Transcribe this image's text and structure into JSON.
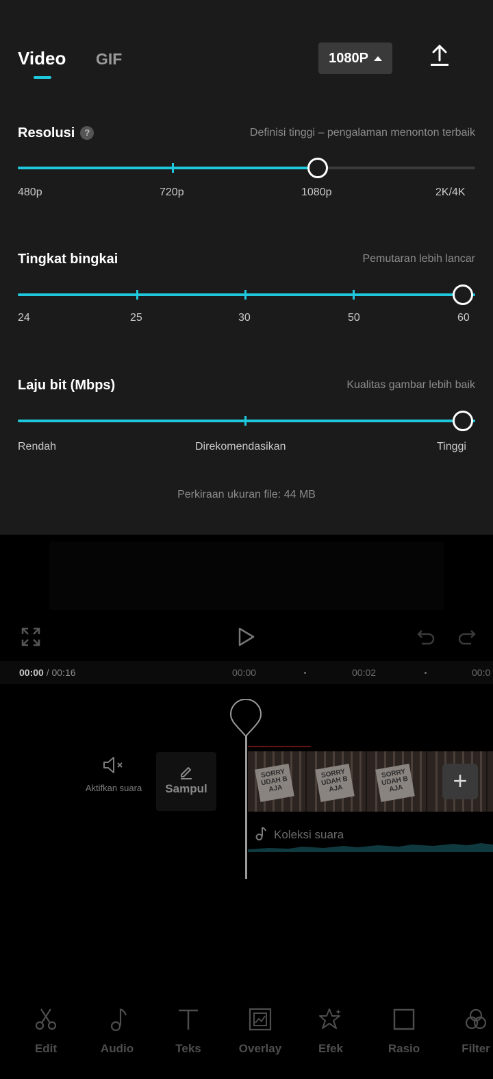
{
  "export": {
    "tabs": [
      {
        "label": "Video",
        "active": true
      },
      {
        "label": "GIF",
        "active": false
      }
    ],
    "resolution_button": "1080P",
    "resolution": {
      "title": "Resolusi",
      "help": "?",
      "hint": "Definisi tinggi – pengalaman menonton terbaik",
      "labels": [
        "480p",
        "720p",
        "1080p",
        "2K/4K"
      ],
      "selected": "1080p"
    },
    "frame_rate": {
      "title": "Tingkat bingkai",
      "hint": "Pemutaran lebih lancar",
      "labels": [
        "24",
        "25",
        "30",
        "50",
        "60"
      ],
      "selected": "60"
    },
    "bitrate": {
      "title": "Laju bit (Mbps)",
      "hint": "Kualitas gambar lebih baik",
      "labels": [
        "Rendah",
        "Direkomendasikan",
        "Tinggi"
      ],
      "selected": "Tinggi"
    },
    "file_size": "Perkiraan ukuran file: 44 MB"
  },
  "editor": {
    "current_time": "00:00",
    "total_time": " / 00:16",
    "ruler": [
      "00:00",
      "00:02",
      "00:0"
    ],
    "mute_label": "Aktifkan suara",
    "cover_label": "Sampul",
    "clip_sticker_text": "SORRY UDAH B AJA",
    "add_clip": "+",
    "audio_label": "Koleksi suara",
    "accent_color": "#1fc8dc",
    "toolbar": [
      {
        "label": "Edit",
        "icon": "scissors-icon"
      },
      {
        "label": "Audio",
        "icon": "music-note-icon"
      },
      {
        "label": "Teks",
        "icon": "text-icon"
      },
      {
        "label": "Overlay",
        "icon": "overlay-icon"
      },
      {
        "label": "Efek",
        "icon": "effects-star-icon"
      },
      {
        "label": "Rasio",
        "icon": "aspect-ratio-icon"
      },
      {
        "label": "Filter",
        "icon": "filter-icon"
      }
    ]
  }
}
